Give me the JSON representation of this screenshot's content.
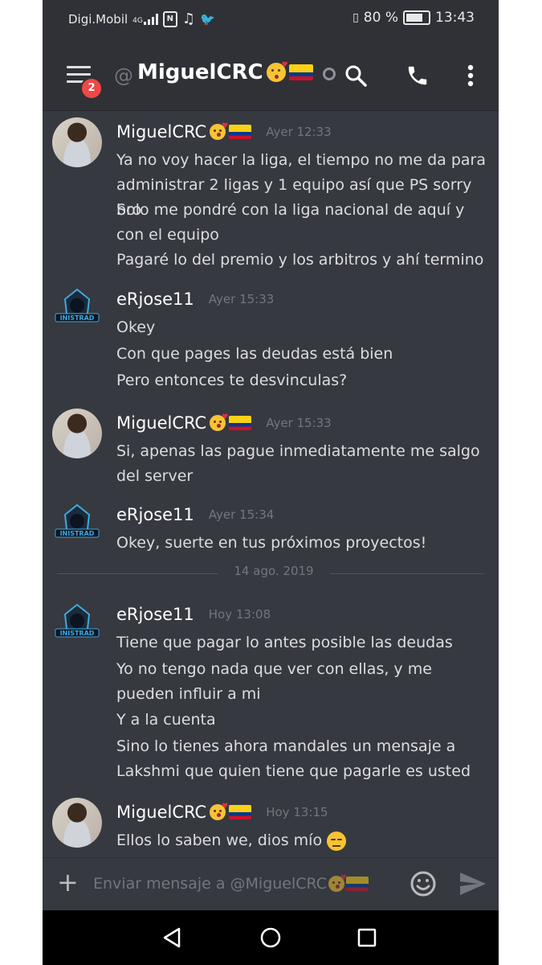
{
  "status_bar": {
    "carrier": "Digi.Mobil",
    "network": "4G",
    "battery_percent": "80 %",
    "time": "13:43"
  },
  "header": {
    "menu_badge": "2",
    "at_symbol": "@",
    "channel_name": "MiguelCRC",
    "icons": [
      "hamburger-icon",
      "search-icon",
      "phone-icon",
      "more-vertical-icon"
    ]
  },
  "messages": [
    {
      "author": "MiguelCRC",
      "avatar": "avatar-miguel",
      "timestamp": "Ayer 12:33",
      "lines": [
        "Ya no voy hacer la liga, el tiempo no me da para administrar 2 ligas y 1 equipo así que PS sorry bro",
        "Solo me pondré con la liga nacional de aquí y con el equipo",
        "Pagaré lo del premio y los arbitros y ahí termino"
      ]
    },
    {
      "author": "eRjose11",
      "avatar": "avatar-erjose",
      "avatar_text": "INISTRAD",
      "timestamp": "Ayer 15:33",
      "lines": [
        "Okey",
        "Con que pages las deudas está bien",
        "Pero entonces te desvinculas?"
      ]
    },
    {
      "author": "MiguelCRC",
      "avatar": "avatar-miguel",
      "timestamp": "Ayer 15:33",
      "lines": [
        "Si, apenas las pague inmediatamente me salgo del server"
      ]
    },
    {
      "author": "eRjose11",
      "avatar": "avatar-erjose",
      "avatar_text": "INISTRAD",
      "timestamp": "Ayer 15:34",
      "lines": [
        "Okey, suerte en tus próximos proyectos!"
      ]
    },
    {
      "author": "eRjose11",
      "avatar": "avatar-erjose",
      "avatar_text": "INISTRAD",
      "timestamp": "Hoy 13:08",
      "lines": [
        "Tiene que pagar lo antes posible las deudas",
        "Yo no tengo nada que ver con ellas, y me pueden influir a mi",
        "Y a la cuenta",
        "Sino lo tienes ahora mandales un mensaje a Lakshmi que quien tiene que pagarle es usted"
      ]
    },
    {
      "author": "MiguelCRC",
      "avatar": "avatar-miguel",
      "timestamp": "Hoy 13:15",
      "lines": [
        "Ellos lo saben we, dios mío"
      ]
    }
  ],
  "date_divider": "14 ago. 2019",
  "composer": {
    "placeholder": "Enviar mensaje a @MiguelCRC"
  },
  "colors": {
    "background": "#36393f",
    "header": "#2f3136",
    "text": "#dcddde",
    "muted": "#72767d",
    "badge": "#f04747",
    "accent": "#7289da"
  }
}
